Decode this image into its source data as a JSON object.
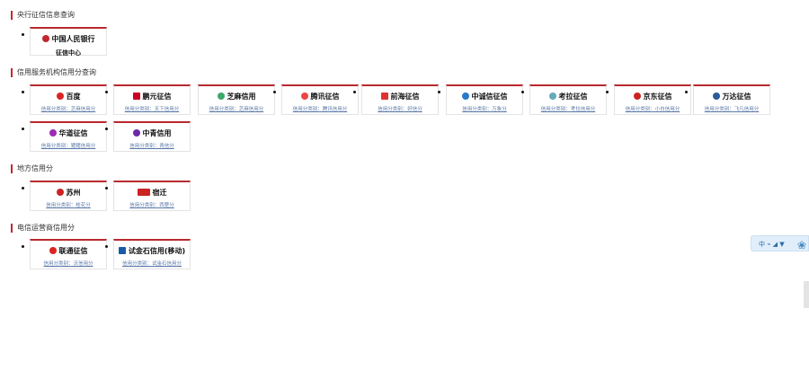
{
  "sections": {
    "s1": {
      "title": "央行征信信息查询"
    },
    "s2": {
      "title": "信用服务机构信用分查询"
    },
    "s3": {
      "title": "地方信用分"
    },
    "s4": {
      "title": "电信运营商信用分"
    }
  },
  "cards": {
    "pboc": {
      "name": "中国人民银行",
      "sub": "征信中心"
    },
    "baidu": {
      "name": "百度",
      "sub": "信用分类别：芝麻信用分"
    },
    "zhaoyi": {
      "name": "鹏元征信",
      "sub": "信用分类别：天下信用分"
    },
    "zhima": {
      "name": "芝麻信用",
      "sub": "信用分类别：芝麻信用分"
    },
    "tencent": {
      "name": "腾讯征信",
      "sub": "信用分类别：腾讯信用分"
    },
    "qianhai": {
      "name": "前海征信",
      "sub": "信用分类别：好信分"
    },
    "zhongzheng": {
      "name": "中诚信征信",
      "sub": "信用分类别：万象分"
    },
    "kaola": {
      "name": "考拉征信",
      "sub": "信用分类别：考拉信用分"
    },
    "jingdong": {
      "name": "京东征信",
      "sub": "信用分类别：小白信用分"
    },
    "wanda": {
      "name": "万达征信",
      "sub": "信用分类别：飞凡信用分"
    },
    "huadao": {
      "name": "华道征信",
      "sub": "信用分类别：猪猪信用分"
    },
    "zhongcheng": {
      "name": "中青信用",
      "sub": "信用分类别：青信分"
    },
    "suzhou": {
      "name": "苏州",
      "sub": "信用分类别：桂花分"
    },
    "suqian": {
      "name": "宿迁",
      "sub": "信用分类别：西楚分"
    },
    "unicom": {
      "name": "联通征信",
      "sub": "信用分类别：沃信用分"
    },
    "mobile": {
      "name": "试金石信用(移动)",
      "sub": "信用分类别：试金石信用分"
    }
  },
  "widget": {
    "label": "中 ⌁ ◢ ▼"
  },
  "colors": {
    "accent": "#c0282d",
    "link": "#5a78a8"
  }
}
